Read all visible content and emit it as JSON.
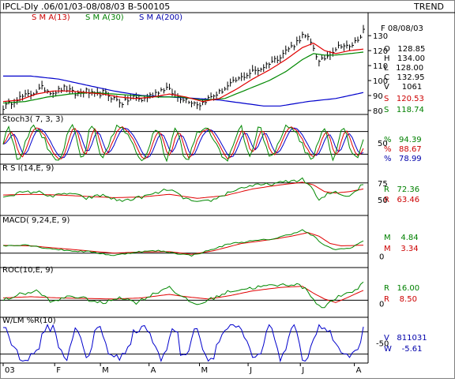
{
  "header": {
    "title": "IPCL-Dly .06/01/03-08/08/03  B-500105",
    "trend_label": "TREND",
    "sma13_label": "S M A(13)",
    "sma30_label": "S M A(30)",
    "sma200_label": "S M A(200)"
  },
  "colors": {
    "price": "#000000",
    "red": "#e00000",
    "green": "#008800",
    "blue": "#0000cc",
    "label_green": "#008000",
    "label_red": "#cc0000",
    "label_blue": "#0000aa"
  },
  "x_axis": {
    "ticks": [
      {
        "label": "03",
        "pos": 0.0
      },
      {
        "label": "F",
        "pos": 0.143
      },
      {
        "label": "M",
        "pos": 0.27
      },
      {
        "label": "A",
        "pos": 0.405
      },
      {
        "label": "M",
        "pos": 0.545
      },
      {
        "label": "J",
        "pos": 0.68
      },
      {
        "label": "J",
        "pos": 0.825
      },
      {
        "label": "A",
        "pos": 0.975
      }
    ]
  },
  "panels": {
    "price": {
      "right_values": {
        "date": "F 08/08/03",
        "open": "O   128.85",
        "high": "H   134.00",
        "low": "L   128.00",
        "close": "C   132.95",
        "volume": "V     1061",
        "sma_red": "S   120.53",
        "sma_green": "S   118.74"
      }
    },
    "stoch": {
      "label": "Stoch3( 7, 3, 3)",
      "right_values": {
        "k": "%   94.39",
        "d": "%   88.67",
        "slow": "%   78.99"
      }
    },
    "rsi": {
      "label": "R S I(14,E, 9)",
      "right_values": {
        "rsi": "R   72.36",
        "avg": "R   63.46"
      }
    },
    "macd": {
      "label": "MACD( 9,24,E, 9)",
      "right_values": {
        "macd": "M    4.84",
        "signal": "M    3.34"
      }
    },
    "roc": {
      "label": "ROC(10,E, 9)",
      "right_values": {
        "roc": "R   16.00",
        "avg": "R    8.50"
      }
    },
    "wlm": {
      "label": "W/LM %R(10)",
      "right_values": {
        "v": "V   811031",
        "w": "W    -5.61"
      }
    }
  },
  "chart_data": [
    {
      "type": "line",
      "name": "price",
      "ylim": [
        80,
        138
      ],
      "yticks": [
        80,
        90,
        100,
        110,
        120,
        130
      ],
      "anchors_close": [
        [
          0,
          82
        ],
        [
          5,
          88
        ],
        [
          10,
          91
        ],
        [
          14,
          95
        ],
        [
          18,
          92
        ],
        [
          22,
          95
        ],
        [
          26,
          91
        ],
        [
          30,
          93
        ],
        [
          33,
          90
        ],
        [
          36,
          92
        ],
        [
          40,
          88
        ],
        [
          43,
          85
        ],
        [
          47,
          89
        ],
        [
          50,
          87
        ],
        [
          53,
          90
        ],
        [
          56,
          93
        ],
        [
          59,
          95
        ],
        [
          62,
          90
        ],
        [
          65,
          88
        ],
        [
          68,
          86
        ],
        [
          71,
          84
        ],
        [
          74,
          88
        ],
        [
          78,
          92
        ],
        [
          81,
          96
        ],
        [
          84,
          100
        ],
        [
          87,
          103
        ],
        [
          90,
          106
        ],
        [
          93,
          108
        ],
        [
          96,
          112
        ],
        [
          99,
          115
        ],
        [
          102,
          120
        ],
        [
          105,
          124
        ],
        [
          108,
          130
        ],
        [
          110,
          128
        ],
        [
          112,
          122
        ],
        [
          114,
          112
        ],
        [
          116,
          115
        ],
        [
          119,
          120
        ],
        [
          122,
          124
        ],
        [
          125,
          122
        ],
        [
          128,
          128
        ],
        [
          130,
          133
        ]
      ],
      "anchors_sma_red": [
        [
          0,
          86
        ],
        [
          6,
          87
        ],
        [
          12,
          91
        ],
        [
          18,
          93
        ],
        [
          24,
          93
        ],
        [
          30,
          92
        ],
        [
          36,
          91
        ],
        [
          42,
          89
        ],
        [
          48,
          88
        ],
        [
          54,
          89
        ],
        [
          60,
          91
        ],
        [
          66,
          89
        ],
        [
          72,
          86
        ],
        [
          78,
          88
        ],
        [
          84,
          94
        ],
        [
          90,
          101
        ],
        [
          96,
          107
        ],
        [
          102,
          114
        ],
        [
          108,
          122
        ],
        [
          112,
          125
        ],
        [
          116,
          120
        ],
        [
          120,
          118
        ],
        [
          125,
          120
        ],
        [
          130,
          121
        ]
      ],
      "anchors_sma_green": [
        [
          0,
          85
        ],
        [
          8,
          86
        ],
        [
          16,
          89
        ],
        [
          24,
          91
        ],
        [
          32,
          92
        ],
        [
          40,
          91
        ],
        [
          48,
          90
        ],
        [
          56,
          89
        ],
        [
          64,
          89
        ],
        [
          72,
          87
        ],
        [
          80,
          88
        ],
        [
          88,
          94
        ],
        [
          96,
          100
        ],
        [
          102,
          106
        ],
        [
          108,
          114
        ],
        [
          112,
          118
        ],
        [
          116,
          117
        ],
        [
          120,
          117
        ],
        [
          125,
          118
        ],
        [
          130,
          119
        ]
      ],
      "anchors_sma_blue": [
        [
          0,
          103
        ],
        [
          10,
          103
        ],
        [
          20,
          101
        ],
        [
          30,
          97
        ],
        [
          40,
          93
        ],
        [
          50,
          90
        ],
        [
          60,
          89
        ],
        [
          70,
          88
        ],
        [
          78,
          87
        ],
        [
          86,
          85
        ],
        [
          94,
          83
        ],
        [
          100,
          83
        ],
        [
          110,
          86
        ],
        [
          120,
          88
        ],
        [
          130,
          92
        ]
      ]
    },
    {
      "type": "line",
      "name": "stochastic",
      "ylim": [
        0,
        100
      ],
      "reference_lines": [
        20,
        50,
        80
      ],
      "ytick_labels": [
        50
      ]
    },
    {
      "type": "line",
      "name": "rsi",
      "ylim": [
        30,
        90
      ],
      "reference_lines": [
        75
      ],
      "ytick_labels": [
        75,
        50
      ],
      "anchors_rsi": [
        [
          0,
          55
        ],
        [
          6,
          60
        ],
        [
          12,
          62
        ],
        [
          18,
          55
        ],
        [
          24,
          60
        ],
        [
          30,
          52
        ],
        [
          36,
          57
        ],
        [
          42,
          48
        ],
        [
          48,
          52
        ],
        [
          54,
          58
        ],
        [
          60,
          66
        ],
        [
          64,
          55
        ],
        [
          70,
          45
        ],
        [
          76,
          50
        ],
        [
          82,
          62
        ],
        [
          88,
          70
        ],
        [
          94,
          72
        ],
        [
          100,
          75
        ],
        [
          104,
          78
        ],
        [
          108,
          80
        ],
        [
          111,
          70
        ],
        [
          114,
          48
        ],
        [
          117,
          58
        ],
        [
          120,
          62
        ],
        [
          124,
          55
        ],
        [
          127,
          62
        ],
        [
          130,
          74
        ]
      ],
      "anchors_rsi_avg": [
        [
          0,
          57
        ],
        [
          10,
          58
        ],
        [
          20,
          57
        ],
        [
          30,
          55
        ],
        [
          40,
          53
        ],
        [
          50,
          54
        ],
        [
          60,
          58
        ],
        [
          70,
          52
        ],
        [
          80,
          56
        ],
        [
          90,
          66
        ],
        [
          100,
          72
        ],
        [
          108,
          76
        ],
        [
          112,
          72
        ],
        [
          116,
          62
        ],
        [
          120,
          60
        ],
        [
          125,
          62
        ],
        [
          130,
          66
        ]
      ]
    },
    {
      "type": "line",
      "name": "macd",
      "ylim": [
        -5,
        12
      ],
      "zero_line": 0,
      "ytick_labels": [
        0
      ],
      "anchors_macd": [
        [
          0,
          3
        ],
        [
          8,
          3.5
        ],
        [
          16,
          2
        ],
        [
          24,
          1
        ],
        [
          32,
          0.5
        ],
        [
          40,
          -1
        ],
        [
          48,
          0.5
        ],
        [
          56,
          1
        ],
        [
          62,
          0
        ],
        [
          68,
          -1
        ],
        [
          74,
          1
        ],
        [
          82,
          4
        ],
        [
          90,
          5
        ],
        [
          98,
          6
        ],
        [
          104,
          8
        ],
        [
          108,
          9.5
        ],
        [
          112,
          7
        ],
        [
          116,
          3
        ],
        [
          120,
          1.5
        ],
        [
          125,
          2
        ],
        [
          130,
          5
        ]
      ],
      "anchors_signal": [
        [
          0,
          3.2
        ],
        [
          10,
          3
        ],
        [
          20,
          2
        ],
        [
          30,
          1
        ],
        [
          40,
          0
        ],
        [
          50,
          0.5
        ],
        [
          60,
          0.6
        ],
        [
          68,
          -0.5
        ],
        [
          76,
          1
        ],
        [
          86,
          4
        ],
        [
          96,
          5.5
        ],
        [
          104,
          7
        ],
        [
          110,
          8.5
        ],
        [
          114,
          7
        ],
        [
          118,
          4
        ],
        [
          122,
          3
        ],
        [
          130,
          3.3
        ]
      ]
    },
    {
      "type": "line",
      "name": "roc",
      "ylim": [
        -12,
        22
      ],
      "zero_line": 0,
      "ytick_labels": [
        0
      ],
      "anchors_roc": [
        [
          0,
          0
        ],
        [
          6,
          5
        ],
        [
          12,
          8
        ],
        [
          18,
          -2
        ],
        [
          24,
          4
        ],
        [
          30,
          1
        ],
        [
          36,
          -3
        ],
        [
          42,
          3
        ],
        [
          48,
          -2
        ],
        [
          54,
          5
        ],
        [
          60,
          12
        ],
        [
          64,
          3
        ],
        [
          70,
          -4
        ],
        [
          76,
          2
        ],
        [
          82,
          8
        ],
        [
          88,
          10
        ],
        [
          94,
          12
        ],
        [
          100,
          13
        ],
        [
          106,
          14
        ],
        [
          110,
          8
        ],
        [
          113,
          -3
        ],
        [
          116,
          -6
        ],
        [
          120,
          2
        ],
        [
          124,
          5
        ],
        [
          128,
          10
        ],
        [
          130,
          16
        ]
      ],
      "anchors_roc_avg": [
        [
          0,
          2
        ],
        [
          10,
          3
        ],
        [
          20,
          2
        ],
        [
          30,
          1.5
        ],
        [
          40,
          1
        ],
        [
          50,
          2
        ],
        [
          60,
          5
        ],
        [
          66,
          3
        ],
        [
          74,
          1
        ],
        [
          82,
          4
        ],
        [
          90,
          8
        ],
        [
          100,
          11
        ],
        [
          108,
          12
        ],
        [
          112,
          6
        ],
        [
          116,
          1
        ],
        [
          120,
          -2
        ],
        [
          124,
          2
        ],
        [
          130,
          8.5
        ]
      ]
    },
    {
      "type": "line",
      "name": "williams_r",
      "ylim": [
        -100,
        0
      ],
      "reference_lines": [
        -20,
        -80
      ],
      "ytick_labels": [
        -50
      ]
    }
  ]
}
